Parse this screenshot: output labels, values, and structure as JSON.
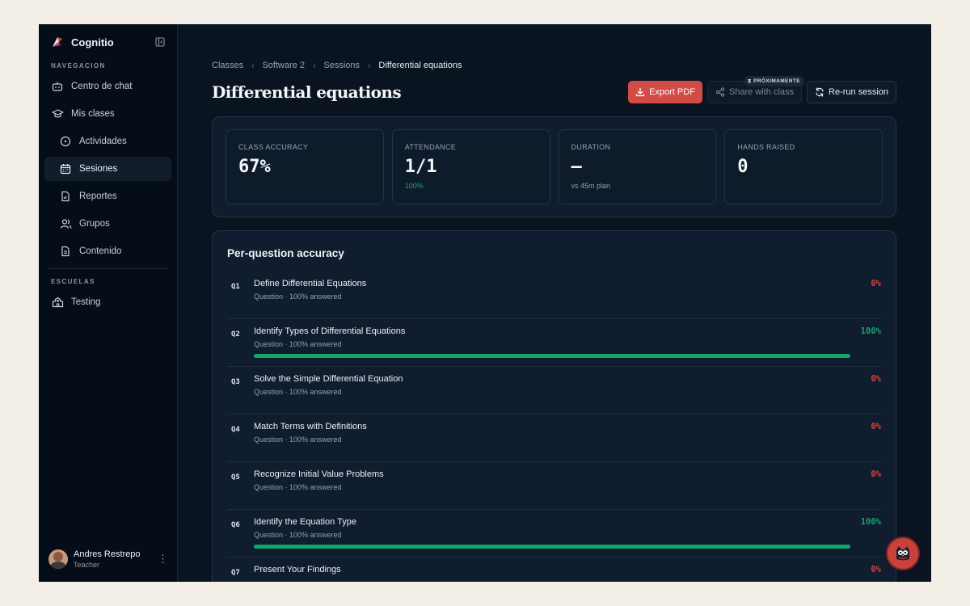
{
  "app": {
    "name": "Cognitio"
  },
  "sidebar": {
    "section_nav": "NAVEGACION",
    "items": [
      {
        "label": "Centro de chat"
      },
      {
        "label": "Mis clases"
      },
      {
        "label": "Actividades"
      },
      {
        "label": "Sesiones"
      },
      {
        "label": "Reportes"
      },
      {
        "label": "Grupos"
      },
      {
        "label": "Contenido"
      }
    ],
    "section_schools": "ESCUELAS",
    "schools": [
      {
        "label": "Testing"
      }
    ]
  },
  "user": {
    "name": "Andres Restrepo",
    "role": "Teacher"
  },
  "breadcrumb": [
    "Classes",
    "Software 2",
    "Sessions",
    "Differential equations"
  ],
  "page": {
    "title": "Differential equations"
  },
  "actions": {
    "export": "Export PDF",
    "share": "Share with class",
    "share_badge": "PRÓXIMAMENTE",
    "rerun": "Re-run session"
  },
  "stats": [
    {
      "label": "CLASS ACCURACY",
      "value": "67%",
      "sub": ""
    },
    {
      "label": "ATTENDANCE",
      "value": "1/1",
      "sub": "100%"
    },
    {
      "label": "DURATION",
      "value": "—",
      "sub": "vs 45m plan"
    },
    {
      "label": "HANDS RAISED",
      "value": "0",
      "sub": ""
    }
  ],
  "accuracy": {
    "title": "Per-question accuracy",
    "questions": [
      {
        "num": "Q1",
        "title": "Define Differential Equations",
        "meta": "Question · 100% answered",
        "pct": "0%",
        "value": 0
      },
      {
        "num": "Q2",
        "title": "Identify Types of Differential Equations",
        "meta": "Question · 100% answered",
        "pct": "100%",
        "value": 100
      },
      {
        "num": "Q3",
        "title": "Solve the Simple Differential Equation",
        "meta": "Question · 100% answered",
        "pct": "0%",
        "value": 0
      },
      {
        "num": "Q4",
        "title": "Match Terms with Definitions",
        "meta": "Question · 100% answered",
        "pct": "0%",
        "value": 0
      },
      {
        "num": "Q5",
        "title": "Recognize Initial Value Problems",
        "meta": "Question · 100% answered",
        "pct": "0%",
        "value": 0
      },
      {
        "num": "Q6",
        "title": "Identify the Equation Type",
        "meta": "Question · 100% answered",
        "pct": "100%",
        "value": 100
      },
      {
        "num": "Q7",
        "title": "Present Your Findings",
        "meta": "",
        "pct": "0%",
        "value": 0
      }
    ]
  },
  "colors": {
    "accent": "#d24b45",
    "success": "#12a56c",
    "danger": "#d1463f",
    "background": "#0a1421"
  }
}
